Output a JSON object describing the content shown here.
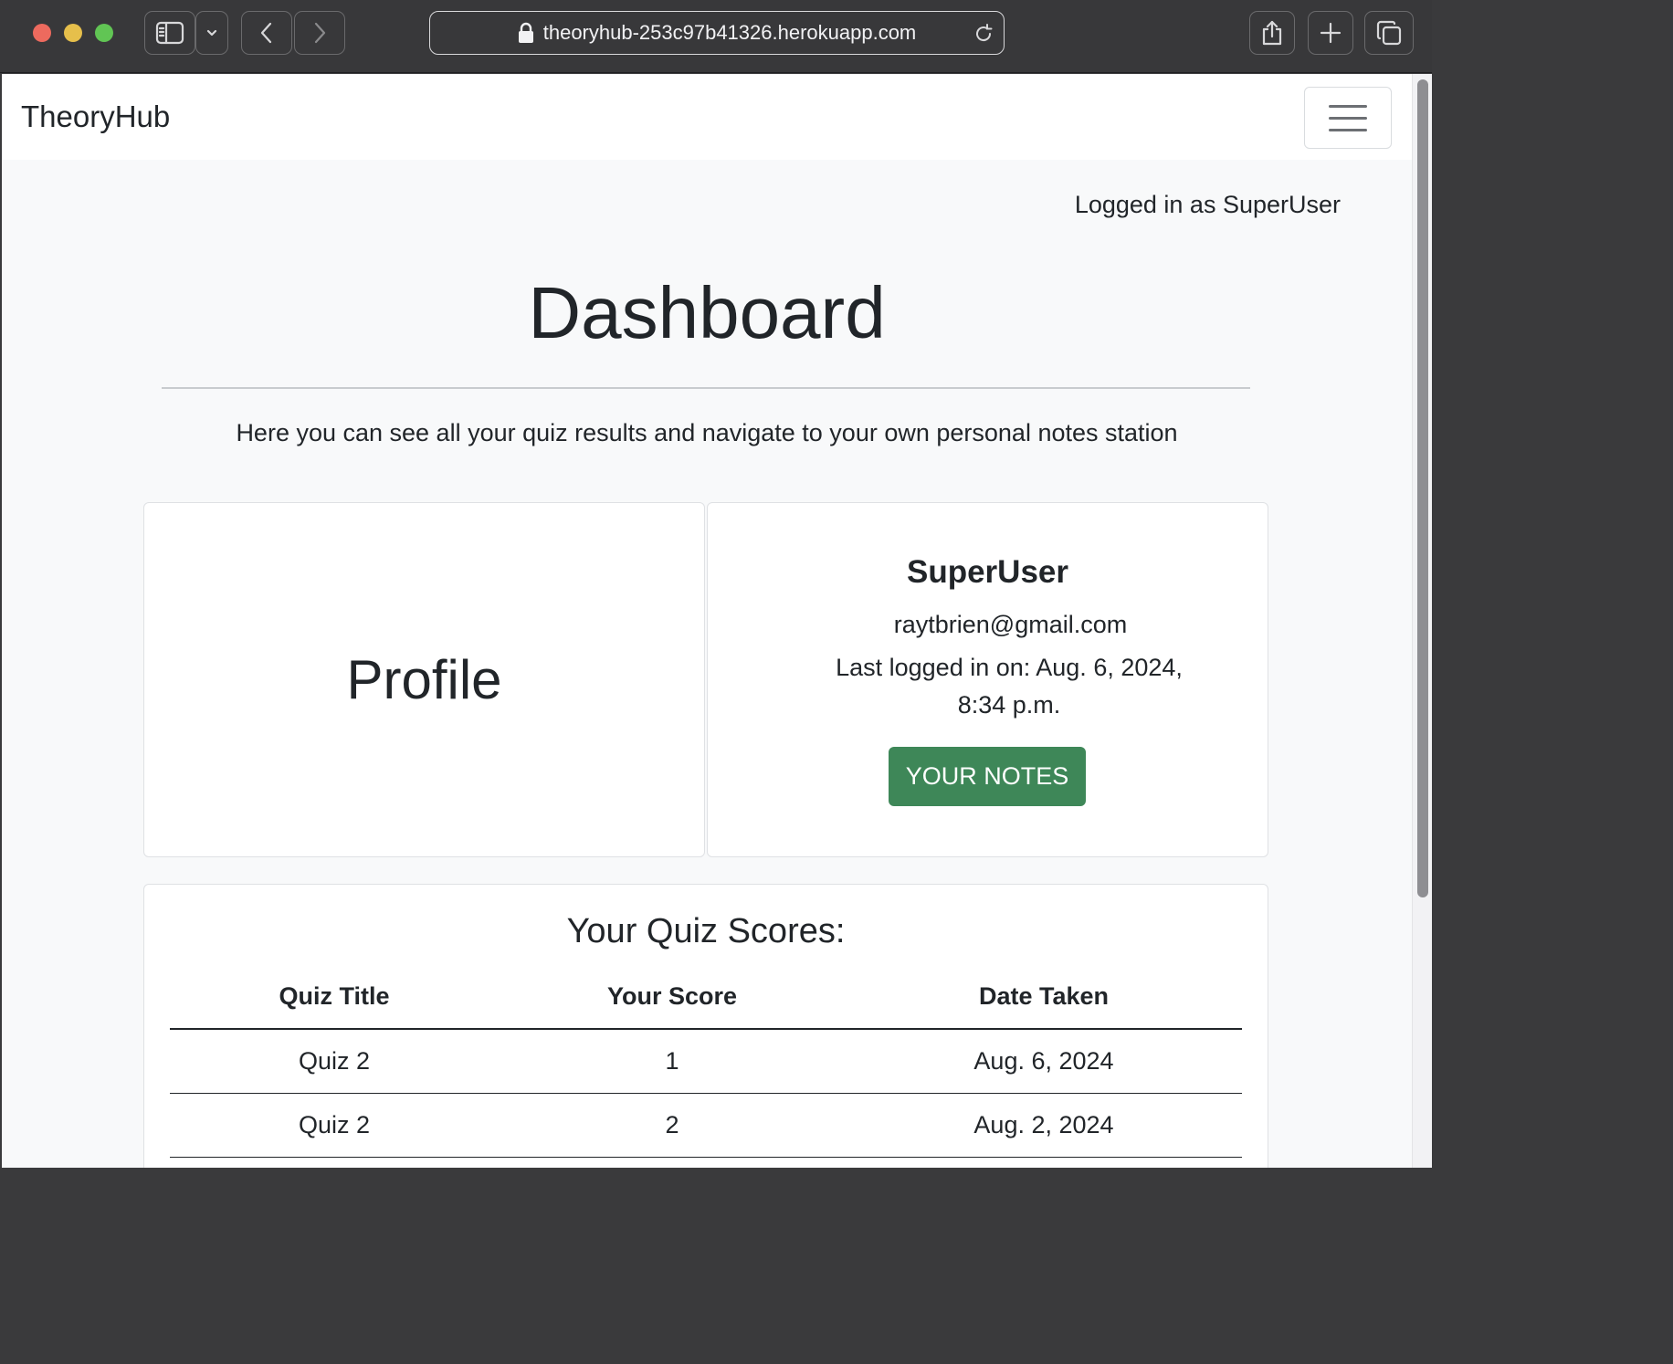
{
  "browser": {
    "url": "theoryhub-253c97b41326.herokuapp.com"
  },
  "navbar": {
    "brand": "TheoryHub"
  },
  "header": {
    "logged_in": "Logged in as SuperUser",
    "title": "Dashboard",
    "lead": "Here you can see all your quiz results and navigate to your own personal notes station"
  },
  "profile": {
    "heading": "Profile"
  },
  "user": {
    "username": "SuperUser",
    "email": "raytbrien@gmail.com",
    "last_login": "Last logged in on: Aug. 6, 2024, 8:34 p.m.",
    "notes_button": "YOUR NOTES",
    "button_color": "#3e8758"
  },
  "scores": {
    "title": "Your Quiz Scores:",
    "columns": [
      "Quiz Title",
      "Your Score",
      "Date Taken"
    ],
    "rows": [
      {
        "quiz": "Quiz 2",
        "score": "1",
        "date": "Aug. 6, 2024"
      },
      {
        "quiz": "Quiz 2",
        "score": "2",
        "date": "Aug. 2, 2024"
      }
    ]
  }
}
